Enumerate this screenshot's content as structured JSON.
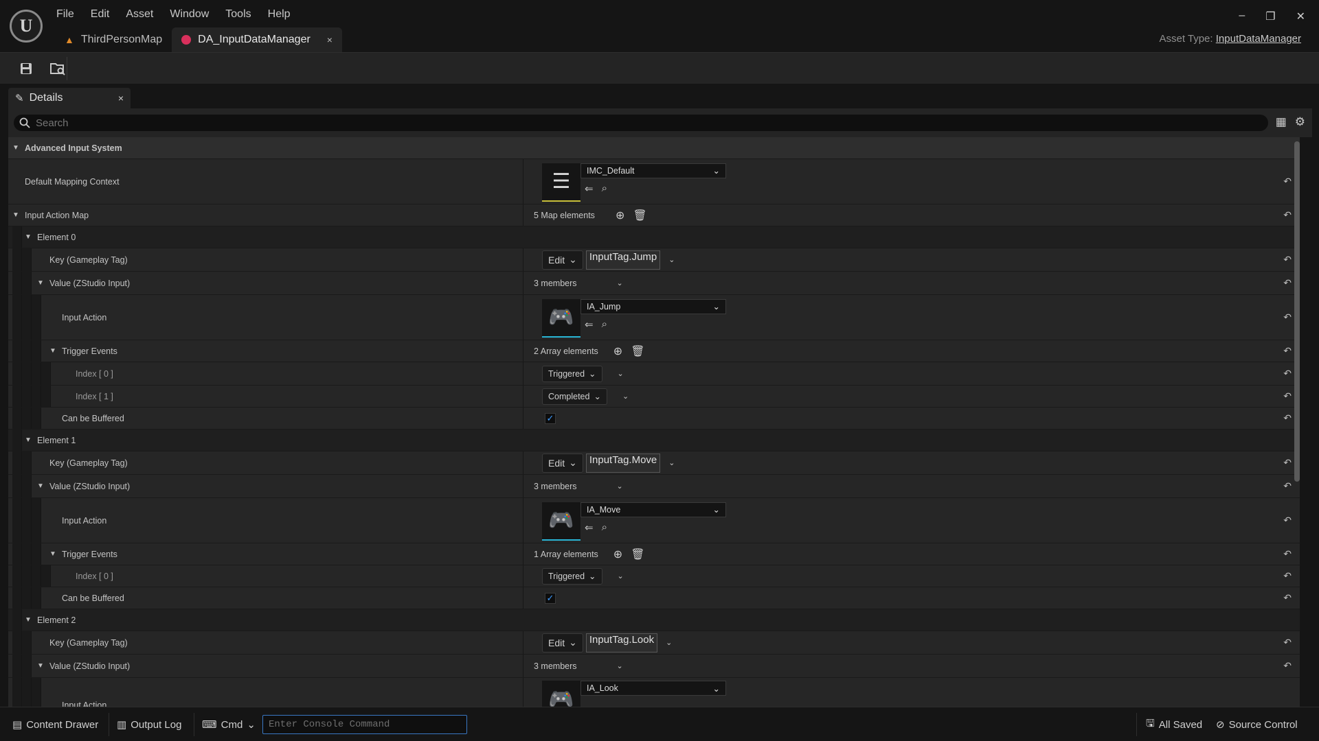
{
  "menu": [
    "File",
    "Edit",
    "Asset",
    "Window",
    "Tools",
    "Help"
  ],
  "tabs": [
    {
      "label": "ThirdPersonMap",
      "icon": "level-icon"
    },
    {
      "label": "DA_InputDataManager",
      "icon": "data-asset-icon",
      "close": "×"
    }
  ],
  "window_controls": {
    "minimize": "–",
    "restore": "❐",
    "close": "✕"
  },
  "asset_type": {
    "label": "Asset Type:",
    "value": "InputDataManager"
  },
  "panel": {
    "title": "Details",
    "close": "×"
  },
  "search": {
    "placeholder": "Search"
  },
  "details": {
    "category": "Advanced Input System",
    "default_mapping_context": {
      "label": "Default Mapping Context",
      "value": "IMC_Default"
    },
    "input_action_map": {
      "label": "Input Action Map",
      "count": "5 Map elements"
    },
    "labels": {
      "key": "Key (Gameplay Tag)",
      "value": "Value (ZStudio Input)",
      "members": "3 members",
      "input_action": "Input Action",
      "trigger_events": "Trigger Events",
      "can_be_buffered": "Can be Buffered",
      "edit": "Edit"
    },
    "elements": [
      {
        "label": "Element 0",
        "tag": "InputTag.Jump",
        "input_action": "IA_Jump",
        "trigger_count": "2 Array elements",
        "triggers": [
          {
            "index": "Index [ 0 ]",
            "value": "Triggered"
          },
          {
            "index": "Index [ 1 ]",
            "value": "Completed"
          }
        ]
      },
      {
        "label": "Element 1",
        "tag": "InputTag.Move",
        "input_action": "IA_Move",
        "trigger_count": "1 Array elements",
        "triggers": [
          {
            "index": "Index [ 0 ]",
            "value": "Triggered"
          }
        ]
      },
      {
        "label": "Element 2",
        "tag": "InputTag.Look",
        "input_action": "IA_Look"
      }
    ]
  },
  "statusbar": {
    "content_drawer": "Content Drawer",
    "output_log": "Output Log",
    "cmd": "Cmd",
    "console_placeholder": "Enter Console Command",
    "all_saved": "All Saved",
    "source_control": "Source Control"
  }
}
